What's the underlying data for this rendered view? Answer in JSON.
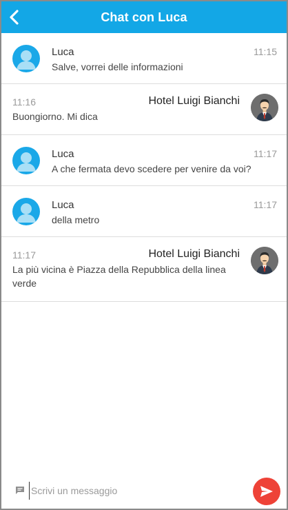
{
  "header": {
    "title": "Chat con Luca",
    "back_icon": "chevron-left-icon",
    "background": "#13a7e6"
  },
  "messages": [
    {
      "side": "left",
      "sender": "Luca",
      "time": "11:15",
      "text": "Salve, vorrei delle informazioni",
      "avatar": "user-silhouette-icon"
    },
    {
      "side": "right",
      "sender": "Hotel Luigi Bianchi",
      "time": "11:16",
      "text": "Buongiorno. Mi dica",
      "avatar": "hotel-manager-avatar"
    },
    {
      "side": "left",
      "sender": "Luca",
      "time": "11:17",
      "text": "A che fermata devo scedere per venire da voi?",
      "avatar": "user-silhouette-icon"
    },
    {
      "side": "left",
      "sender": "Luca",
      "time": "11:17",
      "text": "della metro",
      "avatar": "user-silhouette-icon"
    },
    {
      "side": "right",
      "sender": "Hotel Luigi Bianchi",
      "time": "11:17",
      "text": "La più vicina è Piazza della Repubblica della linea verde",
      "avatar": "hotel-manager-avatar"
    }
  ],
  "composer": {
    "placeholder": "Scrivi un messaggio",
    "chat_icon": "chat-bubble-icon",
    "send_icon": "send-icon",
    "send_color": "#ee4237"
  }
}
